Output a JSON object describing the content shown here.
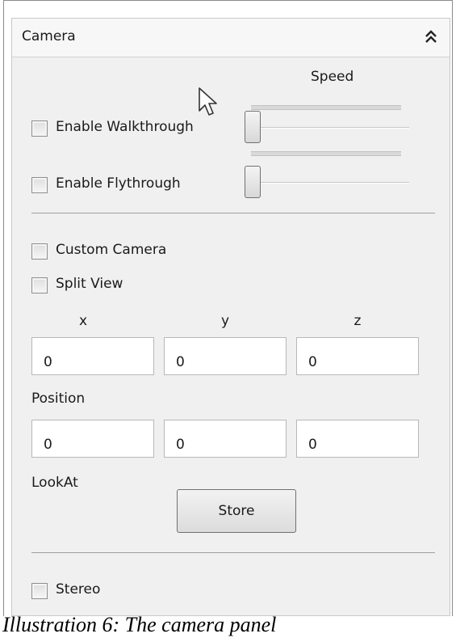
{
  "panel": {
    "title": "Camera",
    "collapse_icon": "double-chevron-up-icon"
  },
  "speed": {
    "label": "Speed",
    "walkthrough": {
      "label": "Enable Walkthrough",
      "checked": false,
      "slider_value": 0
    },
    "flythrough": {
      "label": "Enable Flythrough",
      "checked": false,
      "slider_value": 0
    }
  },
  "options": {
    "custom_camera": {
      "label": "Custom Camera",
      "checked": false
    },
    "split_view": {
      "label": "Split View",
      "checked": false
    }
  },
  "axes": [
    "x",
    "y",
    "z"
  ],
  "position": {
    "values": [
      "0",
      "0",
      "0"
    ],
    "label": "Position"
  },
  "lookat": {
    "values": [
      "0",
      "0",
      "0"
    ],
    "label": "LookAt",
    "store_label": "Store"
  },
  "stereo": {
    "label": "Stereo",
    "checked": false
  },
  "caption": "Illustration 6: The camera panel",
  "cursor_icon": "mouse-pointer-icon",
  "colors": {
    "panel_background": "#f0f0f0",
    "header_background": "#f7f7f7",
    "field_background": "#ffffff",
    "border": "#8a8a8a"
  }
}
